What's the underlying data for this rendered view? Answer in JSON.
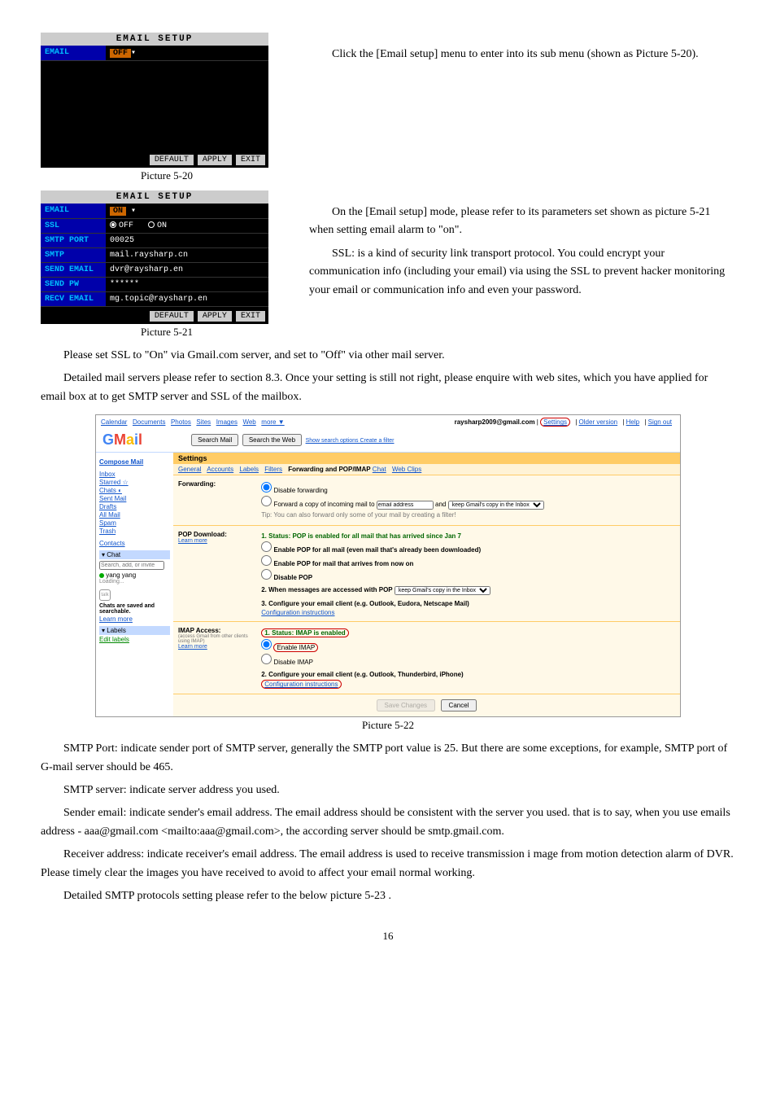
{
  "pic520": {
    "title": "EMAIL SETUP",
    "row1_label": "EMAIL",
    "row1_value": "OFF",
    "btn_default": "DEFAULT",
    "btn_apply": "APPLY",
    "btn_exit": "EXIT",
    "caption": "Picture 5-20"
  },
  "para1": "Click the [Email setup] menu to enter into its sub menu (shown as Picture 5-20).",
  "pic521": {
    "title": "EMAIL SETUP",
    "rows": [
      {
        "label": "EMAIL",
        "value": "ON"
      },
      {
        "label": "SSL",
        "value_off": "OFF",
        "value_on": "ON"
      },
      {
        "label": "SMTP PORT",
        "value": "00025"
      },
      {
        "label": "SMTP",
        "value": "mail.raysharp.cn"
      },
      {
        "label": "SEND EMAIL",
        "value": "dvr@raysharp.en"
      },
      {
        "label": "SEND PW",
        "value": "******"
      },
      {
        "label": "RECV EMAIL",
        "value": "mg.topic@raysharp.en"
      }
    ],
    "btn_default": "DEFAULT",
    "btn_apply": "APPLY",
    "btn_exit": "EXIT",
    "caption": "Picture 5-21"
  },
  "para2a": "On the [Email setup] mode, please refer to its parameters set shown as picture 5-21 when setting email alarm to \"on\".",
  "para2b": "SSL: is a kind of security link transport protocol. You could encrypt your communication info (including your email) via using the SSL to prevent hacker monitoring your email or communication info and even your password.",
  "para3": "Please set SSL to \"On\" via Gmail.com server, and set to \"Off\" via other mail server.",
  "para4": "Detailed mail servers please refer to section 8.3. Once your setting is still not right, please enquire with web sites, which you have applied for email box at to get SMTP server and SSL of the mailbox.",
  "gmail": {
    "top_links": [
      "Calendar",
      "Documents",
      "Photos",
      "Sites",
      "Images",
      "Web",
      "more ▼"
    ],
    "account": "raysharp2009@gmail.com",
    "top_right": [
      "Settings",
      "Older version",
      "Help",
      "Sign out"
    ],
    "search_mail": "Search Mail",
    "search_web": "Search the Web",
    "search_opts": "Show search options\nCreate a filter",
    "compose": "Compose Mail",
    "side": [
      "Inbox",
      "Starred ☆",
      "Chats ◐",
      "Sent Mail",
      "Drafts",
      "All Mail",
      "Spam",
      "Trash",
      "",
      "Contacts"
    ],
    "chat_hdr": "▾ Chat",
    "chat_search": "Search, add, or invite",
    "chat_user": "yang yang",
    "chat_loading": "Loading...",
    "talk": "talk",
    "talk_msg": "Chats are saved and searchable.",
    "learn_more": "Learn more",
    "labels_hdr": "▾ Labels",
    "edit_labels": "Edit labels",
    "settings_hdr": "Settings",
    "tabs": [
      "General",
      "Accounts",
      "Labels",
      "Filters",
      "Forwarding and POP/IMAP",
      "Chat",
      "Web Clips"
    ],
    "fwd_label": "Forwarding:",
    "fwd_opt1": "Disable forwarding",
    "fwd_opt2_a": "Forward a copy of incoming mail to",
    "fwd_opt2_b": "email address",
    "fwd_opt2_c": "and",
    "fwd_opt2_d": "keep Gmail's copy in the Inbox",
    "fwd_tip": "Tip: You can also forward only some of your mail by creating a filter!",
    "pop_label": "POP Download:",
    "pop1": "1. Status: POP is enabled for all mail that has arrived since Jan 7",
    "pop1a": "Enable POP for all mail (even mail that's already been downloaded)",
    "pop1b": "Enable POP for mail that arrives from now on",
    "pop1c": "Disable POP",
    "pop2": "2. When messages are accessed with POP",
    "pop2_sel": "keep Gmail's copy in the Inbox",
    "pop3": "3. Configure your email client (e.g. Outlook, Eudora, Netscape Mail)",
    "config_inst": "Configuration instructions",
    "imap_label": "IMAP Access:",
    "imap_sub": "(access Gmail from other clients using IMAP)",
    "imap1": "1. Status: IMAP is enabled",
    "imap1a": "Enable IMAP",
    "imap1b": "Disable IMAP",
    "imap2": "2. Configure your email client (e.g. Outlook, Thunderbird, iPhone)",
    "save": "Save Changes",
    "cancel": "Cancel",
    "caption": "Picture 5-22"
  },
  "para5": "SMTP Port: indicate sender port of SMTP server, generally the SMTP port value is 25. But there are some exceptions, for example, SMTP port of G-mail server should be 465.",
  "para6": "SMTP server: indicate server address you used.",
  "para7": "Sender email: indicate sender's email address. The email address should be consistent with the server you used. that is to say, when you use emails address - aaa@gmail.com <mailto:aaa@gmail.com>, the according server should be smtp.gmail.com.",
  "para8": "Receiver address: indicate receiver's email address. The email address is used to receive transmission i mage from motion detection alarm of DVR. Please timely clear the images you have received to avoid to affect your email normal working.",
  "para9": "Detailed SMTP protocols setting please refer to the below picture 5-23 .",
  "page": "16"
}
